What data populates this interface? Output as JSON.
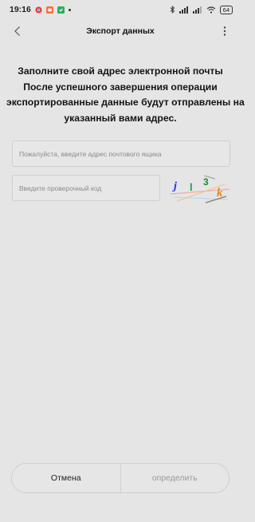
{
  "status_bar": {
    "time": "19:16",
    "battery": "64",
    "app_icon_colors": [
      "#e53935",
      "#ff6d3a",
      "#2fae5f"
    ]
  },
  "header": {
    "title": "Экспорт данных",
    "back_icon": "chevron-left-icon",
    "more_icon": "more-vertical-icon"
  },
  "instruction": {
    "lines": [
      "Заполните свой адрес электронной почты",
      "После успешного завершения операции",
      "экспортированные данные будут отправлены на",
      "указанный вами адрес."
    ]
  },
  "email_field": {
    "value": "",
    "placeholder": "Пожалуйста, введите адрес почтового ящика"
  },
  "code_field": {
    "value": "",
    "placeholder": "Введите проверочный код"
  },
  "captcha": {
    "chars": [
      "j",
      "l",
      "3",
      "k"
    ],
    "colors": [
      "#1f2fd6",
      "#1aa24a",
      "#1a8a2a",
      "#e08a1a"
    ]
  },
  "buttons": {
    "cancel": "Отмена",
    "confirm": "определить"
  },
  "colors": {
    "background": "#e5e5e5",
    "text": "#111111",
    "disabled_text": "#9a9a9a"
  }
}
